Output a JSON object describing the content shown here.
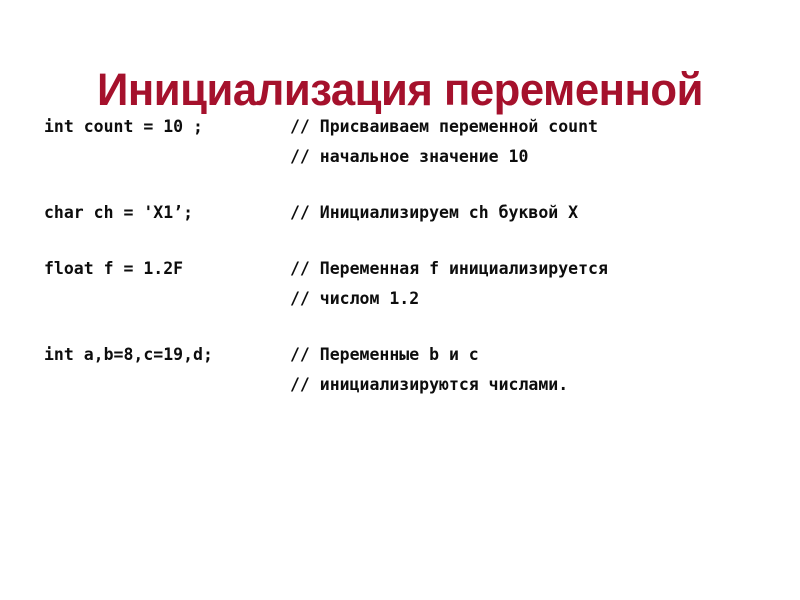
{
  "slide": {
    "title": "Инициализация переменной",
    "title_color": "#A5112C",
    "background_color": "#FFFFFF",
    "text_color": "#0D0D0D"
  },
  "code_blocks": [
    {
      "statement": "int count = 10 ;",
      "comments": [
        "// Присваиваем переменной count",
        "// начальное значение 10"
      ]
    },
    {
      "statement": "char ch = 'X1’;",
      "comments": [
        "// Инициализируем ch буквой X"
      ]
    },
    {
      "statement": "float f = 1.2F",
      "comments": [
        "// Переменная f инициализируется",
        "// числом 1.2"
      ]
    },
    {
      "statement": "int a,b=8,c=19,d;",
      "comments": [
        "// Переменные b и c",
        "// инициализируются числами."
      ]
    }
  ]
}
